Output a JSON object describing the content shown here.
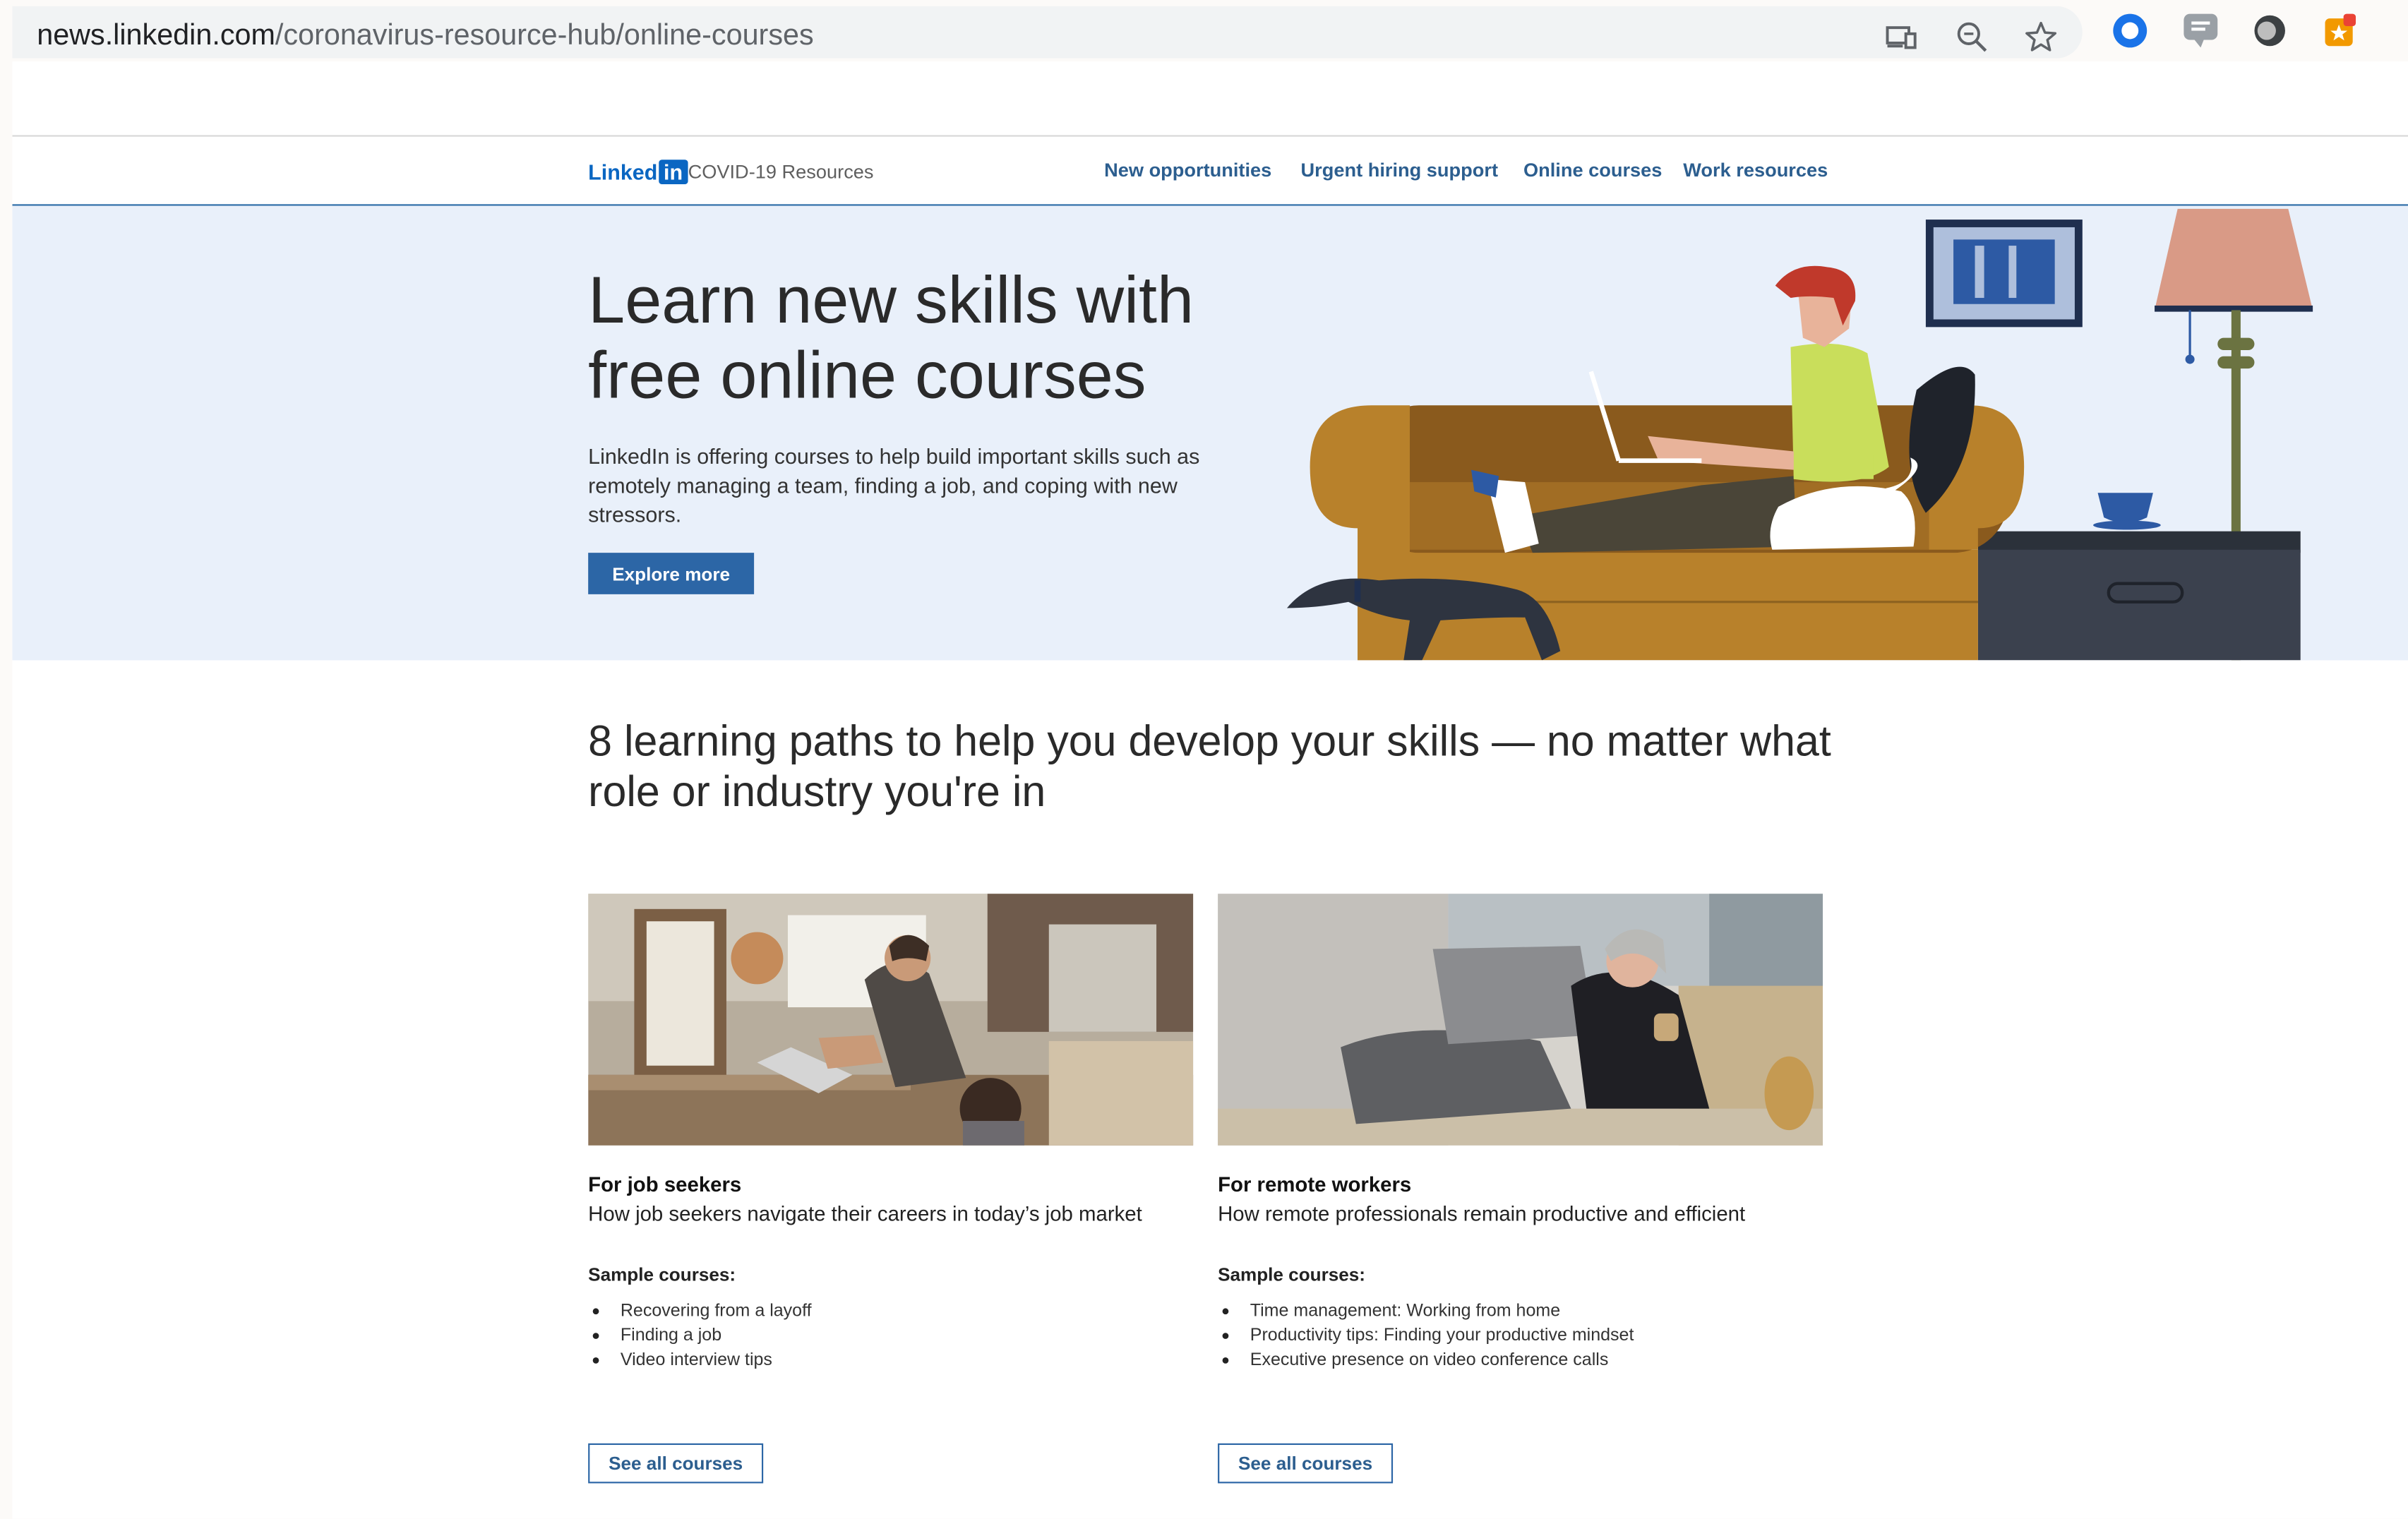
{
  "browser": {
    "url_host": "news.linkedin.com",
    "url_path": "/coronavirus-resource-hub/online-courses",
    "icons": [
      "cast-icon",
      "zoom-icon",
      "bookmark-star-icon"
    ],
    "extensions": [
      "extension-circle-icon",
      "walkme-extension-icon",
      "extension-dark-icon",
      "extension-orange-icon"
    ]
  },
  "nav": {
    "logo_text": "Linked",
    "logo_in": "in",
    "section": "COVID-19 Resources",
    "links": [
      "New opportunities",
      "Urgent hiring support",
      "Online courses",
      "Work resources"
    ]
  },
  "hero": {
    "title": "Learn new skills with free online courses",
    "subtitle": "LinkedIn is offering courses to help build important skills such as remotely managing a team, finding a job, and coping with new stressors.",
    "button": "Explore more"
  },
  "section_title": "8 learning paths to help you develop your skills — no matter what role or industry you're in",
  "cards": [
    {
      "title": "For job seekers",
      "description": "How job seekers navigate their careers in today’s job market",
      "sample_label": "Sample courses:",
      "courses": [
        "Recovering from a layoff",
        "Finding a job",
        "Video interview tips"
      ],
      "button": "See all courses"
    },
    {
      "title": "For remote workers",
      "description": "How remote professionals remain productive and efficient",
      "sample_label": "Sample courses:",
      "courses": [
        "Time management: Working from home",
        "Productivity tips: Finding your productive mindset",
        "Executive presence on video conference calls"
      ],
      "button": "See all courses"
    }
  ],
  "colors": {
    "accent": "#2c66a6",
    "hero_bg": "#e9f0fa",
    "nav_link": "#2c5e8f"
  }
}
